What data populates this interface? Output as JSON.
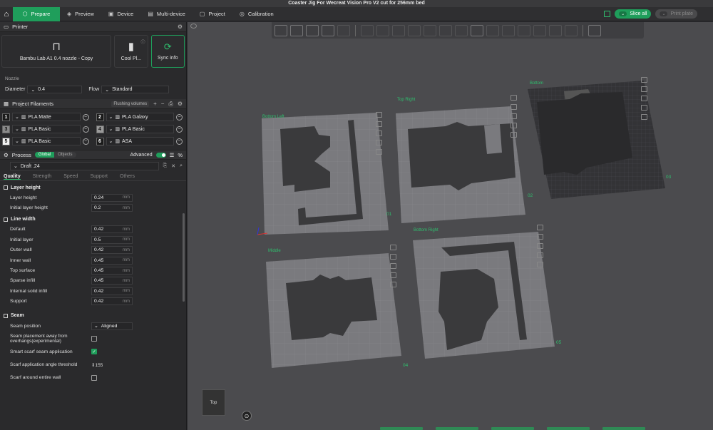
{
  "window_title": "Coaster Jig For Wecreat Vision Pro V2 cut for 256mm bed",
  "nav": {
    "tabs": [
      "Prepare",
      "Preview",
      "Device",
      "Multi-device",
      "Project",
      "Calibration"
    ],
    "active_tab": "Prepare",
    "slice_label": "Slice all",
    "print_label": "Print plate"
  },
  "printer": {
    "section_title": "Printer",
    "printer_name": "Bambu Lab A1 0.4 nozzle - Copy",
    "plate_type": "Cool Pl...",
    "sync_label": "Sync info",
    "nozzle_label": "Nozzle",
    "diameter_label": "Diameter",
    "diameter_value": "0.4",
    "flow_label": "Flow",
    "flow_value": "Standard"
  },
  "filaments": {
    "section_title": "Project Filaments",
    "flushing_label": "Flushing volumes",
    "items": [
      {
        "num": "1",
        "name": "PLA Matte",
        "color": "#1a1a1a"
      },
      {
        "num": "2",
        "name": "PLA Galaxy",
        "color": "#1a1a1a"
      },
      {
        "num": "3",
        "name": "PLA Basic",
        "color": "#8a8a8a"
      },
      {
        "num": "4",
        "name": "PLA Basic",
        "color": "#9a9a9a"
      },
      {
        "num": "5",
        "name": "PLA Basic",
        "color": "#f2f2f2"
      },
      {
        "num": "6",
        "name": "ASA",
        "color": "#1a1a1a"
      }
    ]
  },
  "process": {
    "section_title": "Process",
    "scope_on": "Global",
    "scope_off": "Objects",
    "advanced_label": "Advanced",
    "preset": "Draft .24",
    "subtabs": [
      "Quality",
      "Strength",
      "Speed",
      "Support",
      "Others"
    ],
    "active_subtab": "Quality",
    "layer_height": {
      "title": "Layer height",
      "rows": [
        {
          "label": "Layer height",
          "value": "0.24",
          "unit": "mm"
        },
        {
          "label": "Initial layer height",
          "value": "0.2",
          "unit": "mm"
        }
      ]
    },
    "line_width": {
      "title": "Line width",
      "rows": [
        {
          "label": "Default",
          "value": "0.42",
          "unit": "mm"
        },
        {
          "label": "Initial layer",
          "value": "0.5",
          "unit": "mm"
        },
        {
          "label": "Outer wall",
          "value": "0.42",
          "unit": "mm"
        },
        {
          "label": "Inner wall",
          "value": "0.45",
          "unit": "mm"
        },
        {
          "label": "Top surface",
          "value": "0.45",
          "unit": "mm"
        },
        {
          "label": "Sparse infill",
          "value": "0.45",
          "unit": "mm"
        },
        {
          "label": "Internal solid infill",
          "value": "0.42",
          "unit": "mm"
        },
        {
          "label": "Support",
          "value": "0.42",
          "unit": "mm"
        }
      ]
    },
    "seam": {
      "title": "Seam",
      "position_label": "Seam position",
      "position_value": "Aligned",
      "away_label": "Seam placement away from overhangs(experimental)",
      "scarf_label": "Smart scarf seam application",
      "angle_label": "Scarf application angle threshold",
      "angle_value": "155",
      "entire_label": "Scarf around entire wall"
    }
  },
  "viewport": {
    "plates": [
      {
        "label": "Bottom Left",
        "num": "01"
      },
      {
        "label": "Top Right",
        "num": "02"
      },
      {
        "label": "Bottom",
        "num": "03"
      },
      {
        "label": "Middle",
        "num": "04"
      },
      {
        "label": "Bottom Right",
        "num": "05"
      }
    ],
    "view_label": "Top"
  }
}
